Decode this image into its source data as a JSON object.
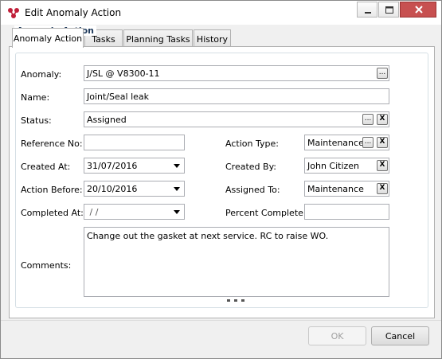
{
  "window": {
    "title": "Edit Anomaly Action"
  },
  "tabs": [
    {
      "label": "Anomaly Action"
    },
    {
      "label": "Tasks"
    },
    {
      "label": "Planning Tasks"
    },
    {
      "label": "History"
    }
  ],
  "form": {
    "group_title": "Anomaly Action",
    "anomaly": {
      "label": "Anomaly:",
      "value": "J/SL @ V8300-11"
    },
    "name": {
      "label": "Name:",
      "value": "Joint/Seal leak"
    },
    "status": {
      "label": "Status:",
      "value": "Assigned"
    },
    "reference_no": {
      "label": "Reference No:",
      "value": ""
    },
    "action_type": {
      "label": "Action Type:",
      "value": "Maintenance"
    },
    "created_at": {
      "label": "Created At:",
      "value": "31/07/2016"
    },
    "created_by": {
      "label": "Created By:",
      "value": "John Citizen"
    },
    "action_before": {
      "label": "Action Before:",
      "value": "20/10/2016"
    },
    "assigned_to": {
      "label": "Assigned To:",
      "value": "Maintenance"
    },
    "completed_at": {
      "label": "Completed At:",
      "value": " / /"
    },
    "percent_complete": {
      "label": "Percent Complete:",
      "value": ""
    },
    "comments": {
      "label": "Comments:",
      "value": "Change out the gasket at next service. RC to raise WO."
    }
  },
  "glyphs": {
    "browse": "...",
    "clear": "X"
  },
  "buttons": {
    "ok": "OK",
    "cancel": "Cancel"
  },
  "colors": {
    "group_title": "#1e395b",
    "close_button": "#c75050"
  }
}
